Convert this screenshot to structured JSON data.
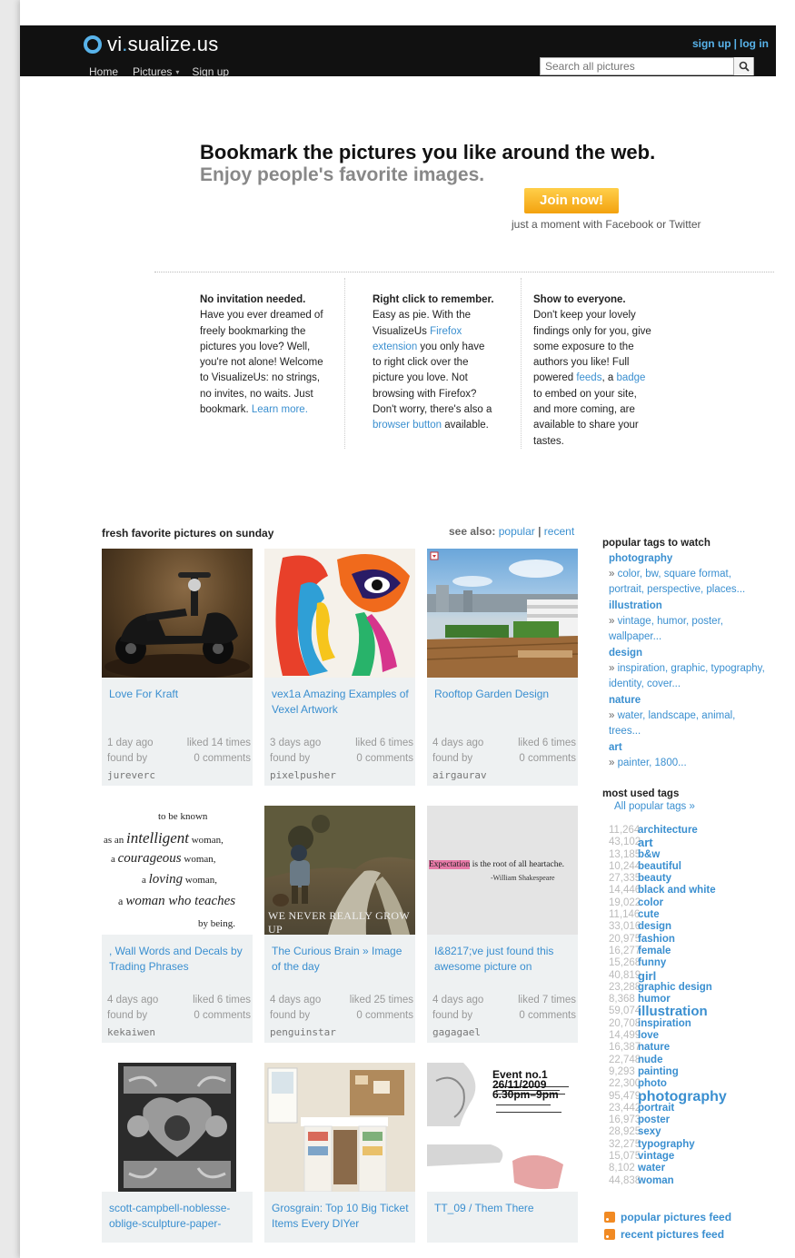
{
  "header": {
    "logo_text_a": "vi",
    "logo_text_dot": ".",
    "logo_text_b": "sualize.us",
    "signup": "sign up",
    "sep": "|",
    "login": "log in",
    "nav": [
      "Home",
      "Pictures",
      "▾",
      "Sign up"
    ],
    "search_placeholder": "Search all pictures"
  },
  "hero": {
    "title": "Bookmark the pictures you like around the web.",
    "subtitle": "Enjoy people's favorite images.",
    "join": "Join now!",
    "note": "just a moment with Facebook or Twitter"
  },
  "features": [
    {
      "heading": "No invitation needed.",
      "lines": [
        "Have you ever dreamed of",
        "freely bookmarking the",
        "pictures you love? Well,",
        "you're not alone! Welcome",
        "to VisualizeUs: no strings,",
        "no invites, no waits. Just"
      ],
      "last_text": "bookmark. ",
      "last_link": "Learn more."
    },
    {
      "heading": "Right click to remember.",
      "l1": "Easy as pie. With the",
      "l2a": "VisualizeUs ",
      "l2b": "Firefox",
      "l3a": "extension",
      "l3b": " you only have",
      "l4": "to right click over the",
      "l5": "picture you love. Not",
      "l6": "browsing with Firefox?",
      "l7": "Don't worry, there's also a",
      "l8a": "browser button",
      "l8b": " available."
    },
    {
      "heading": "Show to everyone.",
      "l1": "Don't keep your lovely",
      "l2": "findings only for you, give",
      "l3": "some exposure to the",
      "l4": "authors you like! Full",
      "l5a": "powered ",
      "l5b": "feeds",
      "l5c": ", a ",
      "l5d": "badge",
      "l6": "to embed on your site,",
      "l7": "and more coming, are",
      "l8": "available to share your",
      "l9": "tastes."
    }
  ],
  "gallery": {
    "title": "fresh favorite pictures on sunday",
    "see_also": "see also:",
    "popular": "popular",
    "sep": "|",
    "recent": "recent",
    "cards": [
      {
        "title": "Love For Kraft",
        "age": "1 day ago",
        "liked": "liked 14 times",
        "found": "found by",
        "comments": "0 comments",
        "user": "jureverc"
      },
      {
        "title": "vex1a Amazing Examples of Vexel Artwork",
        "age": "3 days ago",
        "liked": "liked 6 times",
        "found": "found by",
        "comments": "0 comments",
        "user": "pixelpusher"
      },
      {
        "title": "Rooftop Garden Design",
        "age": "4 days ago",
        "liked": "liked 6 times",
        "found": "found by",
        "comments": "0 comments",
        "user": "airgaurav"
      },
      {
        "title": ", Wall Words and Decals by Trading Phrases",
        "age": "4 days ago",
        "liked": "liked 6 times",
        "found": "found by",
        "comments": "0 comments",
        "user": "kekaiwen"
      },
      {
        "title": "The Curious Brain » Image of the day",
        "age": "4 days ago",
        "liked": "liked 25 times",
        "found": "found by",
        "comments": "0 comments",
        "user": "penguinstar"
      },
      {
        "title": "I&8217;ve just found this awesome picture on",
        "age": "4 days ago",
        "liked": "liked 7 times",
        "found": "found by",
        "comments": "0 comments",
        "user": "gagagael"
      },
      {
        "title": "scott-campbell-noblesse-oblige-sculpture-paper-",
        "age": "",
        "liked": "",
        "found": "",
        "comments": "",
        "user": ""
      },
      {
        "title": "Grosgrain: Top 10 Big Ticket Items Every DIYer",
        "age": "",
        "liked": "",
        "found": "",
        "comments": "",
        "user": ""
      },
      {
        "title": "TT_09 / Them There",
        "age": "",
        "liked": "",
        "found": "",
        "comments": "",
        "user": ""
      }
    ],
    "thumb_text": {
      "wall_1": "to be known",
      "wall_2a": "as an ",
      "wall_2b": "intelligent",
      "wall_2c": " woman,",
      "wall_3a": "a ",
      "wall_3b": "courageous",
      "wall_3c": " woman,",
      "wall_4a": "a ",
      "wall_4b": "loving",
      "wall_4c": " woman,",
      "wall_5a": "a ",
      "wall_5b": "woman who teaches",
      "wall_6": "by being.",
      "brain": "WE NEVER REALLY GROW UP",
      "quote_a": "Expectation",
      "quote_b": " is the root of all heartache.",
      "quote_author": "-William Shakespeare",
      "event_1": "Event no.1",
      "event_2": "26/11/2009",
      "event_3": "6.30pm–9pm"
    }
  },
  "sidebar": {
    "popular_title": "popular tags to watch",
    "groups": [
      {
        "name": "photography",
        "line1": "color, bw, square format,",
        "line2": "portrait, perspective, places..."
      },
      {
        "name": "illustration",
        "line1": "vintage, humor, poster,",
        "line2": "wallpaper..."
      },
      {
        "name": "design",
        "line1": "inspiration, graphic, typography,",
        "line2": "identity, cover..."
      },
      {
        "name": "nature",
        "line1": "water, landscape, animal,",
        "line2": "trees..."
      },
      {
        "name": "art",
        "line1": "painter, 1800...",
        "line2": ""
      }
    ],
    "raquo": "»",
    "most_used_title": "most used tags",
    "all_popular": "All popular tags »",
    "used_tags": [
      {
        "count": "11,264",
        "tag": "architecture"
      },
      {
        "count": "43,102",
        "tag": "art"
      },
      {
        "count": "13,185",
        "tag": "b&w"
      },
      {
        "count": "10,244",
        "tag": "beautiful"
      },
      {
        "count": "27,335",
        "tag": "beauty"
      },
      {
        "count": "14,446",
        "tag": "black and white"
      },
      {
        "count": "19,022",
        "tag": "color"
      },
      {
        "count": "11,146",
        "tag": "cute"
      },
      {
        "count": "33,016",
        "tag": "design"
      },
      {
        "count": "20,975",
        "tag": "fashion"
      },
      {
        "count": "16,277",
        "tag": "female"
      },
      {
        "count": "15,268",
        "tag": "funny"
      },
      {
        "count": "40,819",
        "tag": "girl"
      },
      {
        "count": "23,288",
        "tag": "graphic design"
      },
      {
        "count": "8,368",
        "tag": "humor"
      },
      {
        "count": "59,074",
        "tag": "illustration"
      },
      {
        "count": "20,708",
        "tag": "inspiration"
      },
      {
        "count": "14,499",
        "tag": "love"
      },
      {
        "count": "16,387",
        "tag": "nature"
      },
      {
        "count": "22,748",
        "tag": "nude"
      },
      {
        "count": "9,293",
        "tag": "painting"
      },
      {
        "count": "22,300",
        "tag": "photo"
      },
      {
        "count": "95,479",
        "tag": "photography"
      },
      {
        "count": "23,442",
        "tag": "portrait"
      },
      {
        "count": "16,973",
        "tag": "poster"
      },
      {
        "count": "28,925",
        "tag": "sexy"
      },
      {
        "count": "32,275",
        "tag": "typography"
      },
      {
        "count": "15,075",
        "tag": "vintage"
      },
      {
        "count": "8,102",
        "tag": "water"
      },
      {
        "count": "44,838",
        "tag": "woman"
      }
    ],
    "feed_popular": "popular pictures feed",
    "feed_recent": "recent pictures feed"
  }
}
